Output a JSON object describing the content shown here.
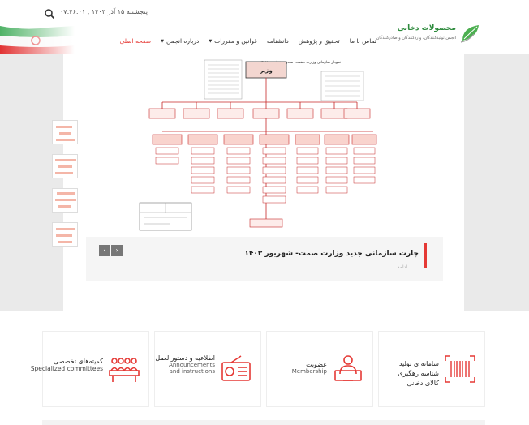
{
  "header": {
    "datetime": "پنجشنبه ۱۵ آذر ۱۴۰۳ , ۰۷:۴۶:۰۱",
    "logo_title": "محصولات دخانی",
    "logo_subtitle": "انجمن تولیدکنندگان، واردکنندگان و صادرکنندگان"
  },
  "nav": {
    "items": [
      {
        "label": "صفحه اصلی",
        "active": true,
        "dropdown": false
      },
      {
        "label": "درباره انجمن",
        "active": false,
        "dropdown": true
      },
      {
        "label": "قوانین و مقررات",
        "active": false,
        "dropdown": true
      },
      {
        "label": "دانشنامه",
        "active": false,
        "dropdown": false
      },
      {
        "label": "تحقیق و پژوهش",
        "active": false,
        "dropdown": false
      },
      {
        "label": "تماس با ما",
        "active": false,
        "dropdown": false
      }
    ]
  },
  "slider": {
    "chart_header": "نمودار سازمانی وزارت صنعت، معدن و تجارت - ۱۴۰۲",
    "top_box": "وزیر",
    "caption_title": "چارت سازمانی جدید وزارت صمت- شهریور ۱۴۰۳",
    "caption_more": "ادامه",
    "prev_icon": "chevron-left-icon",
    "next_icon": "chevron-right-icon"
  },
  "features": [
    {
      "title": "سامانه ی تولید شناسه رهگیری کالای دخانی",
      "line2": "",
      "line3": "",
      "icon": "barcode-icon"
    },
    {
      "title": "عضویت",
      "line2": "Membership",
      "line3": "",
      "icon": "membership-icon"
    },
    {
      "title": "اطلاعیه و دستورالعمل",
      "line2": "Announcements",
      "line3": "and instructions",
      "icon": "radio-icon"
    },
    {
      "title": "کمیته‌های تخصصی",
      "line2": "Specialized committees",
      "line3": "",
      "icon": "committee-icon"
    }
  ],
  "colors": {
    "accent": "#e53935",
    "brand_green": "#2e8b3d"
  }
}
